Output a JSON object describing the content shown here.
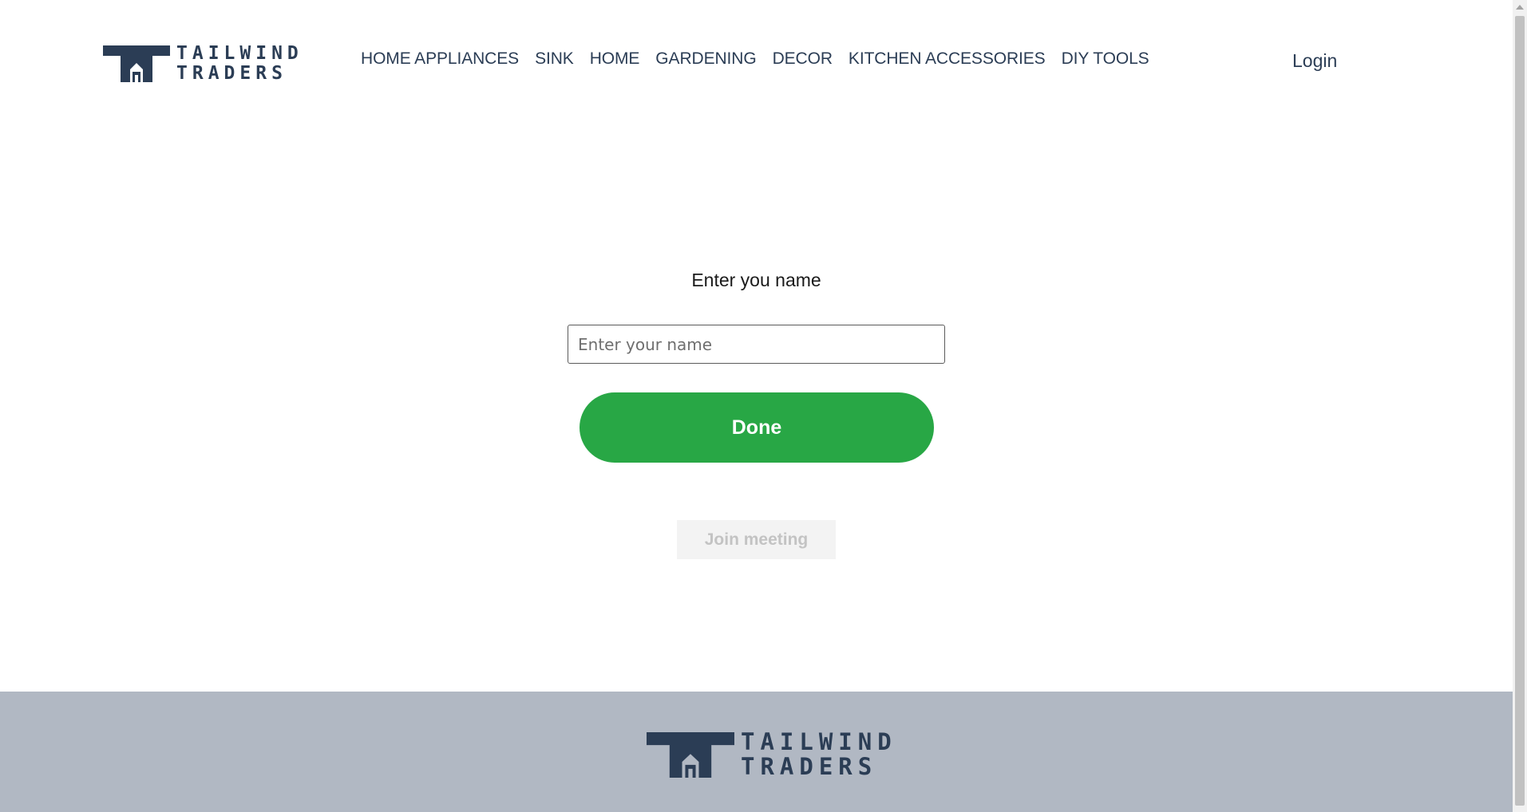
{
  "brand": {
    "line1": "TAILWIND",
    "line2": "TRADERS",
    "color": "#2b3d55"
  },
  "nav": {
    "items": [
      {
        "label": "HOME APPLIANCES"
      },
      {
        "label": "SINK"
      },
      {
        "label": "HOME"
      },
      {
        "label": "GARDENING"
      },
      {
        "label": "DECOR"
      },
      {
        "label": "KITCHEN ACCESSORIES"
      },
      {
        "label": "DIY TOOLS"
      }
    ],
    "login": "Login"
  },
  "form": {
    "title": "Enter you name",
    "name_placeholder": "Enter your name",
    "name_value": "",
    "done_label": "Done",
    "done_color": "#28a745",
    "join_label": "Join meeting"
  },
  "footer": {
    "background": "#b1b8c3"
  },
  "icons": {
    "logo": "house-logo-icon",
    "scroll_up": "scroll-up-arrow-icon"
  }
}
